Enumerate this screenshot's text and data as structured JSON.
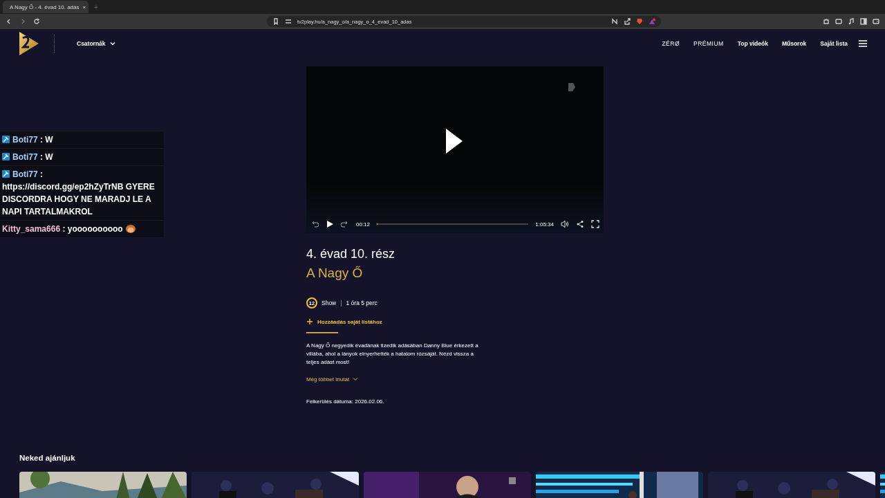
{
  "browser": {
    "tab": {
      "title": "A Nagy Ő - 4. évad 10. adás",
      "close": "×"
    },
    "new_tab": "+",
    "url": "tv2play.hu/a_nagy_o/a_nagy_o_4_evad_10_adas"
  },
  "header": {
    "channels_label": "Csatornák",
    "nav": [
      "ZÉRØ",
      "PRÉMIUM",
      "Top videók",
      "Műsorok",
      "Saját lista"
    ]
  },
  "chat": {
    "messages": [
      {
        "user": "Boti77",
        "colon": ":",
        "text": "W",
        "badge": true,
        "emote": false,
        "color": "#a9cdf2"
      },
      {
        "user": "Boti77",
        "colon": ":",
        "text": "W",
        "badge": true,
        "emote": false,
        "color": "#a9cdf2"
      },
      {
        "user": "Boti77",
        "colon": ":",
        "text": "https://discord.gg/ep2hZyTrNB GYERE DISCORDRA HOGY NE MARADJ LE A NAPI TARTALMAKROL",
        "badge": true,
        "emote": false,
        "color": "#a9cdf2"
      },
      {
        "user": "Kitty_sama666",
        "colon": ":",
        "text": "yoooooooooo",
        "badge": false,
        "emote": true,
        "color": "#f2bfd3"
      }
    ]
  },
  "player": {
    "current": "00:12",
    "total": "1:05:34",
    "level": 0.003
  },
  "episode": {
    "title": "4. évad 10. rész",
    "show": "A Nagy Ő",
    "rating": "12",
    "genre": "Show",
    "separator": "|",
    "duration": "1 óra 5 perc",
    "add_label": "Hozzáadás saját listához",
    "description": "A Nagy Ő negyedik évadának tizedik adásában Danny Blue érkezett a villába, ahol a lányok elnyerhették a hatalom rózsáját. Nézd vissza a teljes adást most!",
    "more_label": "Még többet mutat",
    "release": "Felkerülés dátuma: 2026.02.06."
  },
  "recommended": {
    "title": "Neked ajánljuk"
  }
}
